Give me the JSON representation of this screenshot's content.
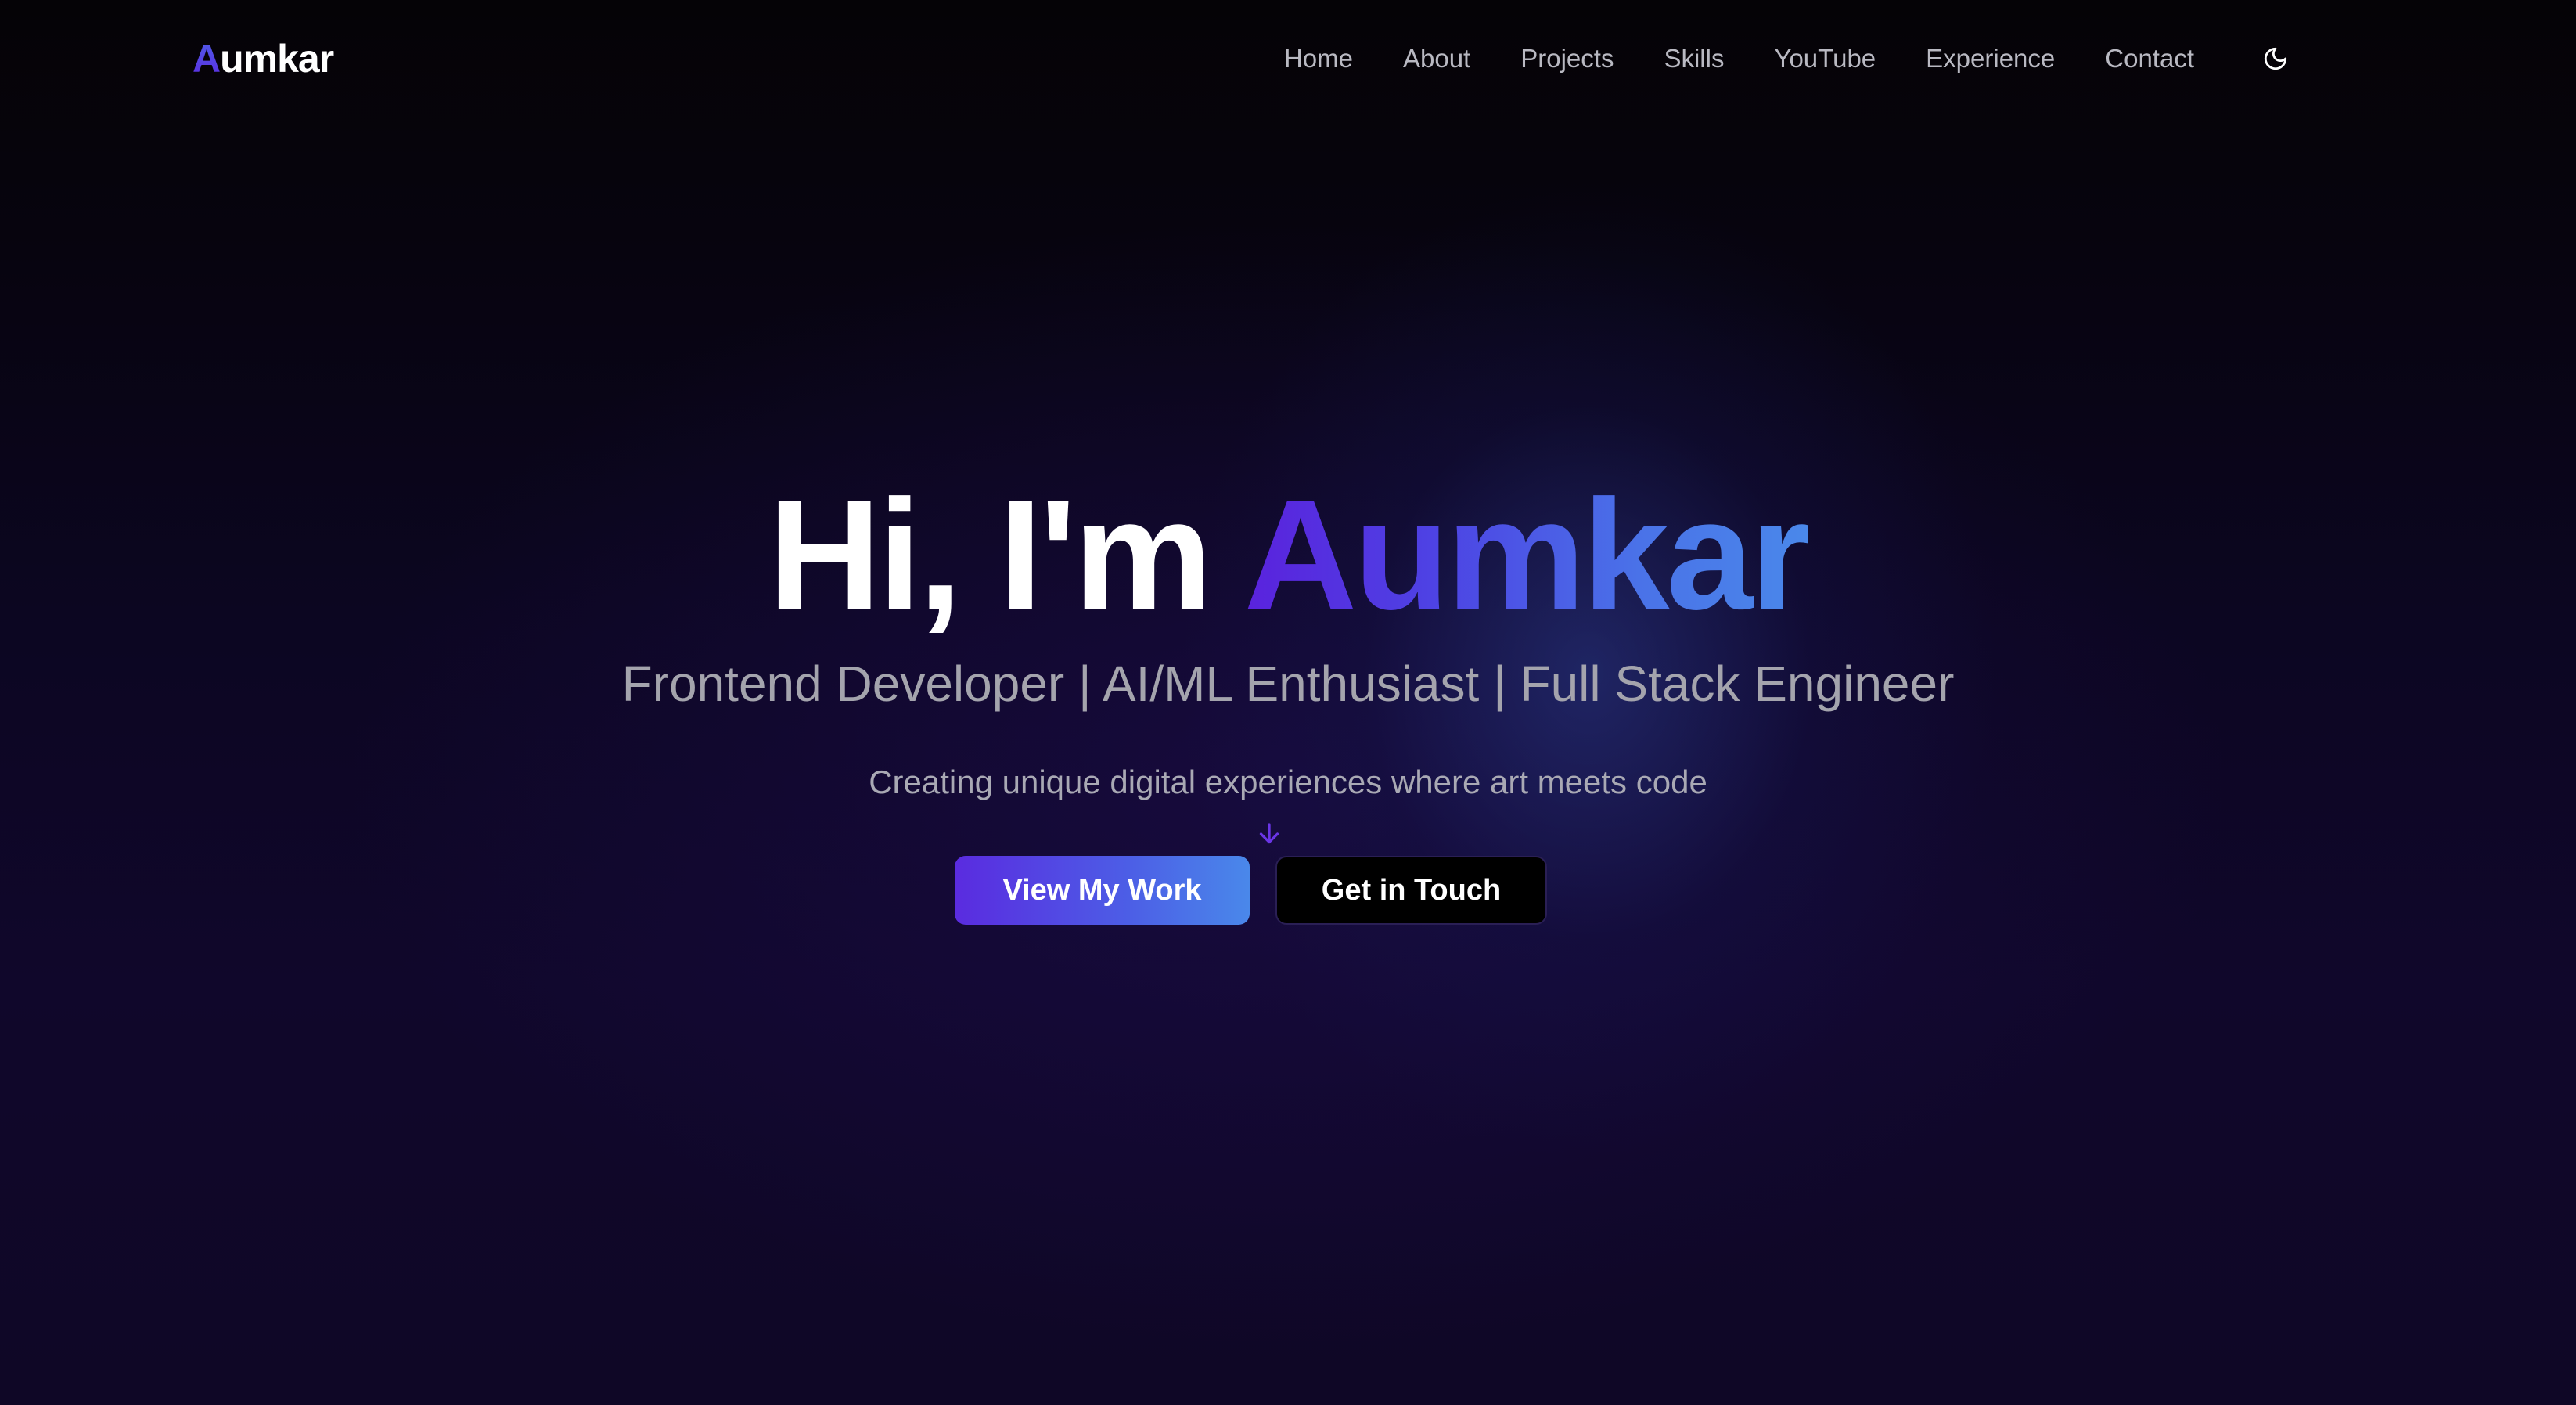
{
  "logo": {
    "first_letter": "A",
    "rest": "umkar"
  },
  "nav": {
    "items": [
      {
        "label": "Home"
      },
      {
        "label": "About"
      },
      {
        "label": "Projects"
      },
      {
        "label": "Skills"
      },
      {
        "label": "YouTube"
      },
      {
        "label": "Experience"
      },
      {
        "label": "Contact"
      }
    ],
    "theme_toggle_icon": "moon-icon"
  },
  "hero": {
    "greeting": "Hi, I'm ",
    "name": "Aumkar",
    "subtitle": "Frontend Developer | AI/ML Enthusiast | Full Stack Engineer",
    "tagline": "Creating unique digital experiences where art meets code",
    "scroll_icon": "arrow-down-icon",
    "primary_button": "View My Work",
    "secondary_button": "Get in Touch"
  },
  "colors": {
    "accent_purple": "#5a22dd",
    "accent_blue": "#4a88ea",
    "background": "#0c0622",
    "nav_text": "#b9b9c2"
  }
}
